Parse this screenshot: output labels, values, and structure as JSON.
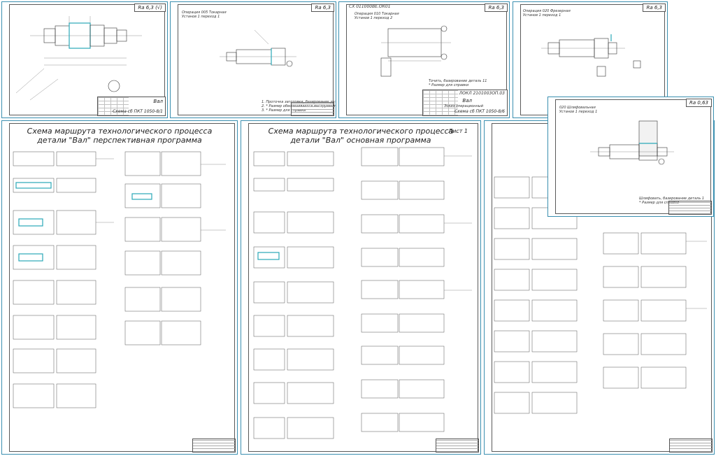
{
  "sheets": {
    "part_drawing": {
      "roughness": "Ra 6,3 (√)",
      "title": "Вал",
      "code": "Схема сб ПКТ 1050-8/1"
    },
    "op1": {
      "roughness": "Ra 6,3",
      "op_text": "Операция 005 Токарная\nУстанов 1 переход 1",
      "notes": "1. Проточка заготовки, базирование деталь 1\n2. * Размер обеспечивается инструментом\n3. * Размер для справки"
    },
    "op2": {
      "header": "СХ 011000ВЕ.ОК01",
      "roughness": "Ra 6,3",
      "op_text": "Операция 010 Токарная\nУстанов 1 переход 2",
      "notes": "Точить, базирование деталь 11\n* Размер для справки",
      "title": "Вал",
      "subtitle": "Эскиз операционный",
      "code": "ЛОКЛ 2101003ОП.03",
      "code2": "Схема сб ПКТ 1050-8/6"
    },
    "op3": {
      "roughness": "Ra 6,3",
      "op_text": "Операция 020 Фрезерная\nУстанов 1 переход 1"
    },
    "op4": {
      "roughness": "Ra 0,63",
      "op_text": "020 Шлифовальная\nУстанов 1 переход 1",
      "notes": "Шлифовать, базирование деталь 1\n* Размер для справки"
    },
    "scheme_perspective": {
      "title_line1": "Схема маршрута технологического процесса",
      "title_line2": "детали \"Вал\" перспективная программа"
    },
    "scheme_main": {
      "title_line1": "Схема маршрута технологического процесса",
      "title_line2": "детали \"Вал\" основная программа",
      "sheet_label": "Лист 1"
    }
  },
  "colors": {
    "sheet_border": "#3a8fb0",
    "highlight": "#2aa8b8"
  }
}
